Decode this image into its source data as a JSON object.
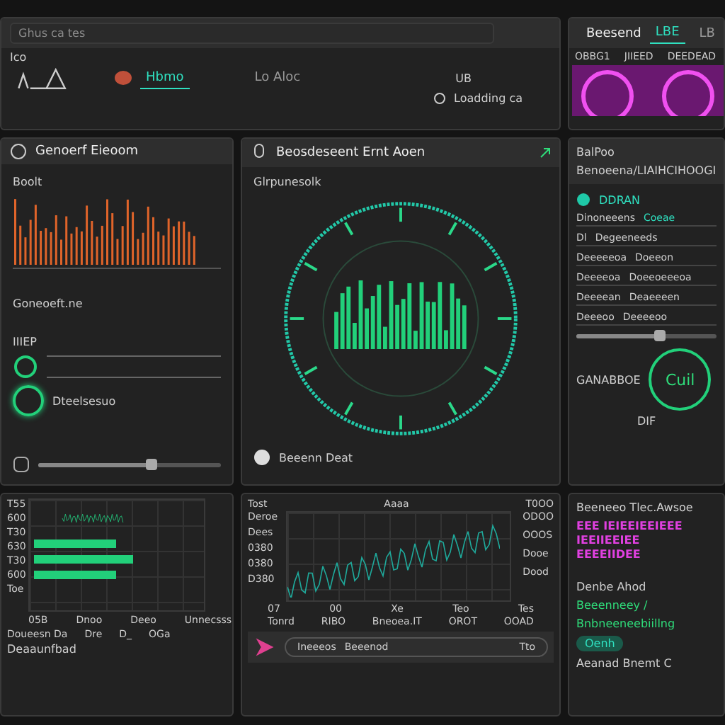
{
  "header": {
    "search": {
      "placeholder": "Ghus ca tes"
    },
    "label": "Ico",
    "tabs": [
      {
        "label": "Hbmo",
        "selected": true
      },
      {
        "label": "Lo Aloc",
        "selected": false
      }
    ],
    "badge": "UB",
    "status": "Loadding ca"
  },
  "preview": {
    "title": "Beesend",
    "tabs": [
      {
        "label": "LBE",
        "selected": true
      },
      {
        "label": "LB",
        "selected": false
      }
    ],
    "labels": [
      "OBBG1",
      "JIIEED",
      "DEEDEAD"
    ]
  },
  "sound_panel": {
    "title": "Genoerf Eieoom",
    "chart_label": "Boolt",
    "section": "Goneoeft.ne",
    "field_label": "IIIEP",
    "toggle": {
      "on": true
    },
    "toggle_label": "Dteelsesuo",
    "slider": {
      "level": 0.62
    }
  },
  "monitor": {
    "title": "Beosdeseent Ernt Aoen",
    "subtitle": "Glrpunesolk",
    "footer": "Beeenn Deat"
  },
  "detail": {
    "label": "BalPoo",
    "heading": "Benoeena/LIAIHCIHOOGI",
    "status": "DDRAN",
    "rows": [
      {
        "name": "Dinoneeens",
        "value": "Coeae"
      },
      {
        "name": "Dl",
        "value": "Degeeneeds"
      },
      {
        "name": "Deeeeeoa",
        "value": "Doeeon"
      },
      {
        "name": "Deeeeoa",
        "value": "Doeeoeeeoa"
      },
      {
        "name": "Deeeean",
        "value": "Deaeeeen"
      },
      {
        "name": "Deeeoo",
        "value": "Deeeeoo"
      }
    ],
    "slider": {
      "level": 0.6
    },
    "gauge_label": "GANABBOE",
    "gauge_value": "Cuil",
    "gauge_sub": "DIF"
  },
  "levels_chart": {
    "yticks": [
      "T55",
      "600",
      "T30",
      "630",
      "T30",
      "600",
      "Toe"
    ],
    "legend": [
      "05B",
      "Dnoo",
      "Deeo",
      "Unnecsss"
    ],
    "items": [
      "Doueesn Da",
      "Dre",
      "D_",
      "OGa"
    ],
    "footer": "Deaaunfbad"
  },
  "trend_chart": {
    "ylabels": [
      "Deroe",
      "Dees",
      "0380",
      "0380",
      "D380"
    ],
    "top": [
      "Tost",
      "Aaaa",
      "T0OO"
    ],
    "rlabels": [
      "ODOO",
      "OOOS",
      "Dooe",
      "Dood"
    ],
    "xticks": [
      "07",
      "00",
      "Xe",
      "Teo",
      "Tes"
    ],
    "legend": [
      "Tonrd",
      "RIBO",
      "Bneoea.IT",
      "OROT",
      "OOAD"
    ],
    "player": {
      "text": "Ineeeos",
      "value": "Beeenod",
      "time": "Tto"
    }
  },
  "alerts": {
    "title": "Beeneeo Tlec.Awsoe",
    "lines": [
      "EEE IEIEEIEEIEEE",
      "IEEIIEEIEE",
      "EEEEIIDEE"
    ],
    "subtitle": "Denbe Ahod",
    "items": [
      "Beeenneey /",
      "Bnbneeneebiillng"
    ],
    "badge": "Oenh",
    "footer": "Aeanad Bnemt C"
  }
}
